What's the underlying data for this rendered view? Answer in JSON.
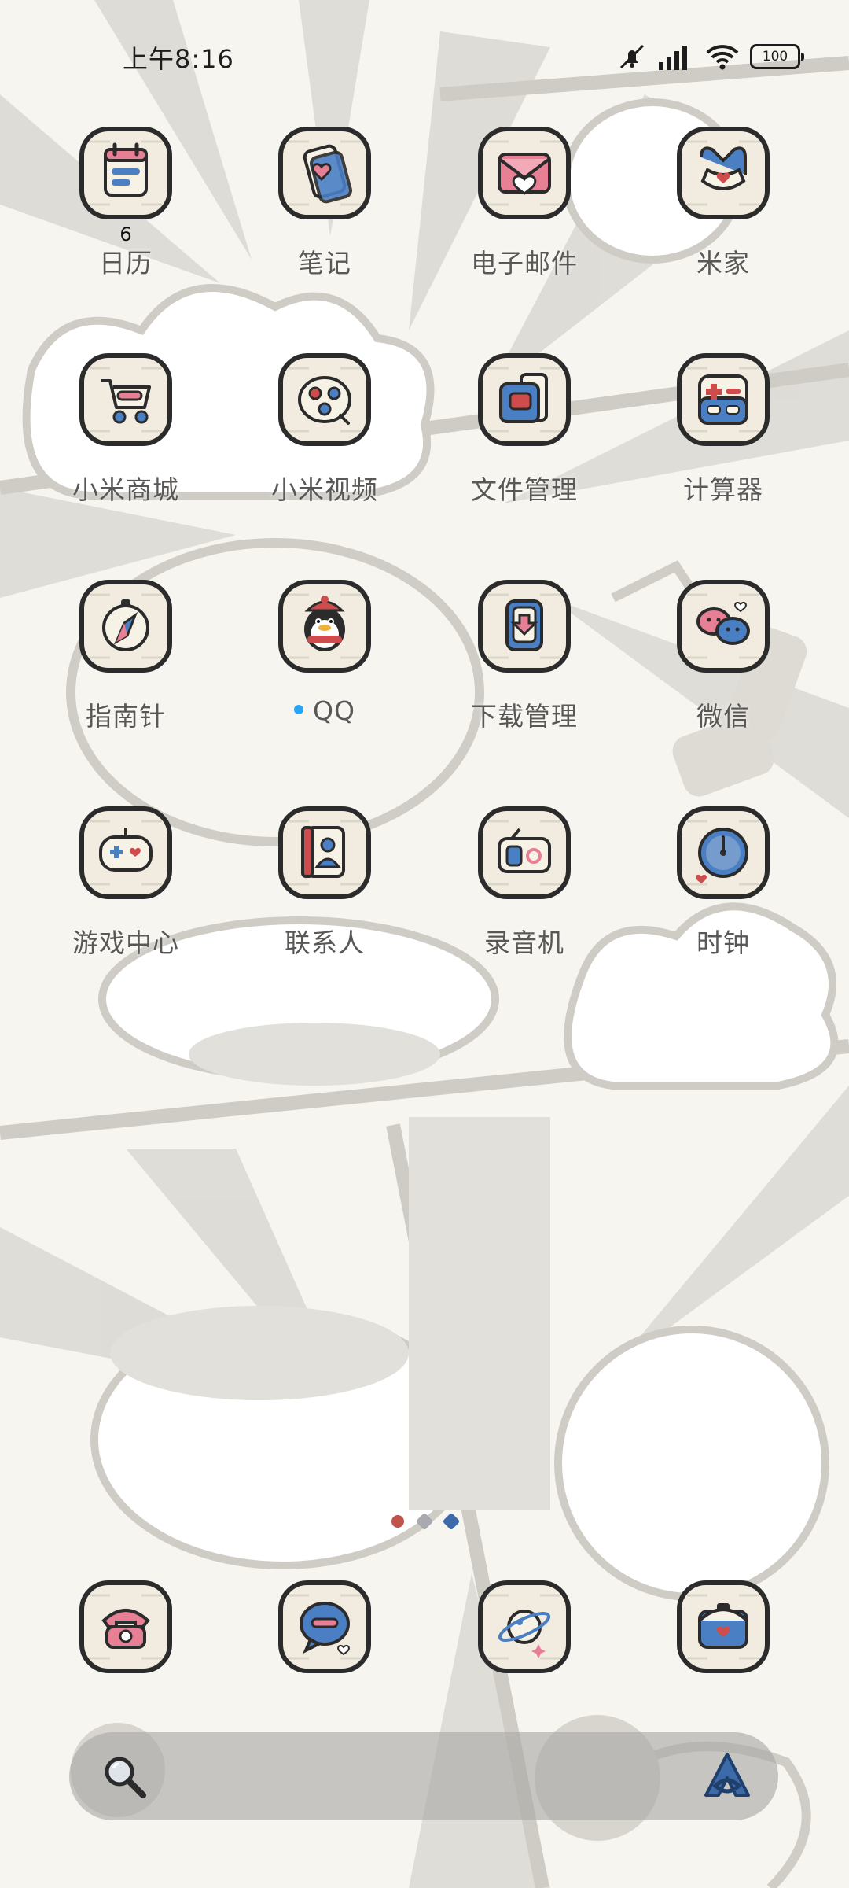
{
  "status_bar": {
    "time": "上午8:16",
    "battery": "100",
    "icons": [
      "mute-icon",
      "signal-icon",
      "wifi-icon",
      "battery-icon"
    ]
  },
  "apps": [
    {
      "name": "app-calendar",
      "label": "日历",
      "icon": "calendar-icon",
      "badge": "6"
    },
    {
      "name": "app-notes",
      "label": "笔记",
      "icon": "notes-icon"
    },
    {
      "name": "app-email",
      "label": "电子邮件",
      "icon": "email-icon"
    },
    {
      "name": "app-mijia",
      "label": "米家",
      "icon": "mijia-icon"
    },
    {
      "name": "app-mi-store",
      "label": "小米商城",
      "icon": "shopping-cart-icon"
    },
    {
      "name": "app-mi-video",
      "label": "小米视频",
      "icon": "video-icon"
    },
    {
      "name": "app-file-manager",
      "label": "文件管理",
      "icon": "folder-icon"
    },
    {
      "name": "app-calculator",
      "label": "计算器",
      "icon": "calculator-icon"
    },
    {
      "name": "app-compass",
      "label": "指南针",
      "icon": "compass-icon"
    },
    {
      "name": "app-qq",
      "label": "QQ",
      "icon": "qq-penguin-icon",
      "new_dot": true
    },
    {
      "name": "app-downloads",
      "label": "下载管理",
      "icon": "download-icon"
    },
    {
      "name": "app-wechat",
      "label": "微信",
      "icon": "chat-bubbles-icon"
    },
    {
      "name": "app-game-center",
      "label": "游戏中心",
      "icon": "gamepad-icon"
    },
    {
      "name": "app-contacts",
      "label": "联系人",
      "icon": "contacts-book-icon"
    },
    {
      "name": "app-recorder",
      "label": "录音机",
      "icon": "recorder-icon"
    },
    {
      "name": "app-clock",
      "label": "时钟",
      "icon": "clock-icon"
    }
  ],
  "dock": [
    {
      "name": "dock-phone",
      "icon": "phone-icon"
    },
    {
      "name": "dock-messages",
      "icon": "message-icon"
    },
    {
      "name": "dock-browser",
      "icon": "planet-icon"
    },
    {
      "name": "dock-camera",
      "icon": "camera-icon"
    }
  ],
  "page_indicator": {
    "pages": 3,
    "active": 0,
    "colors": [
      "#c0544a",
      "#a8aab0",
      "#3d6aa8"
    ]
  },
  "search": {
    "icon": "search-icon",
    "assistant_icon": "assistant-icon"
  },
  "colors": {
    "icon_bg": "#f2ece0",
    "icon_outline": "#2b2b2b",
    "accent_blue": "#4a7fc4",
    "accent_pink": "#e77f95",
    "accent_red": "#cf4c4c",
    "label": "#5a5856"
  }
}
